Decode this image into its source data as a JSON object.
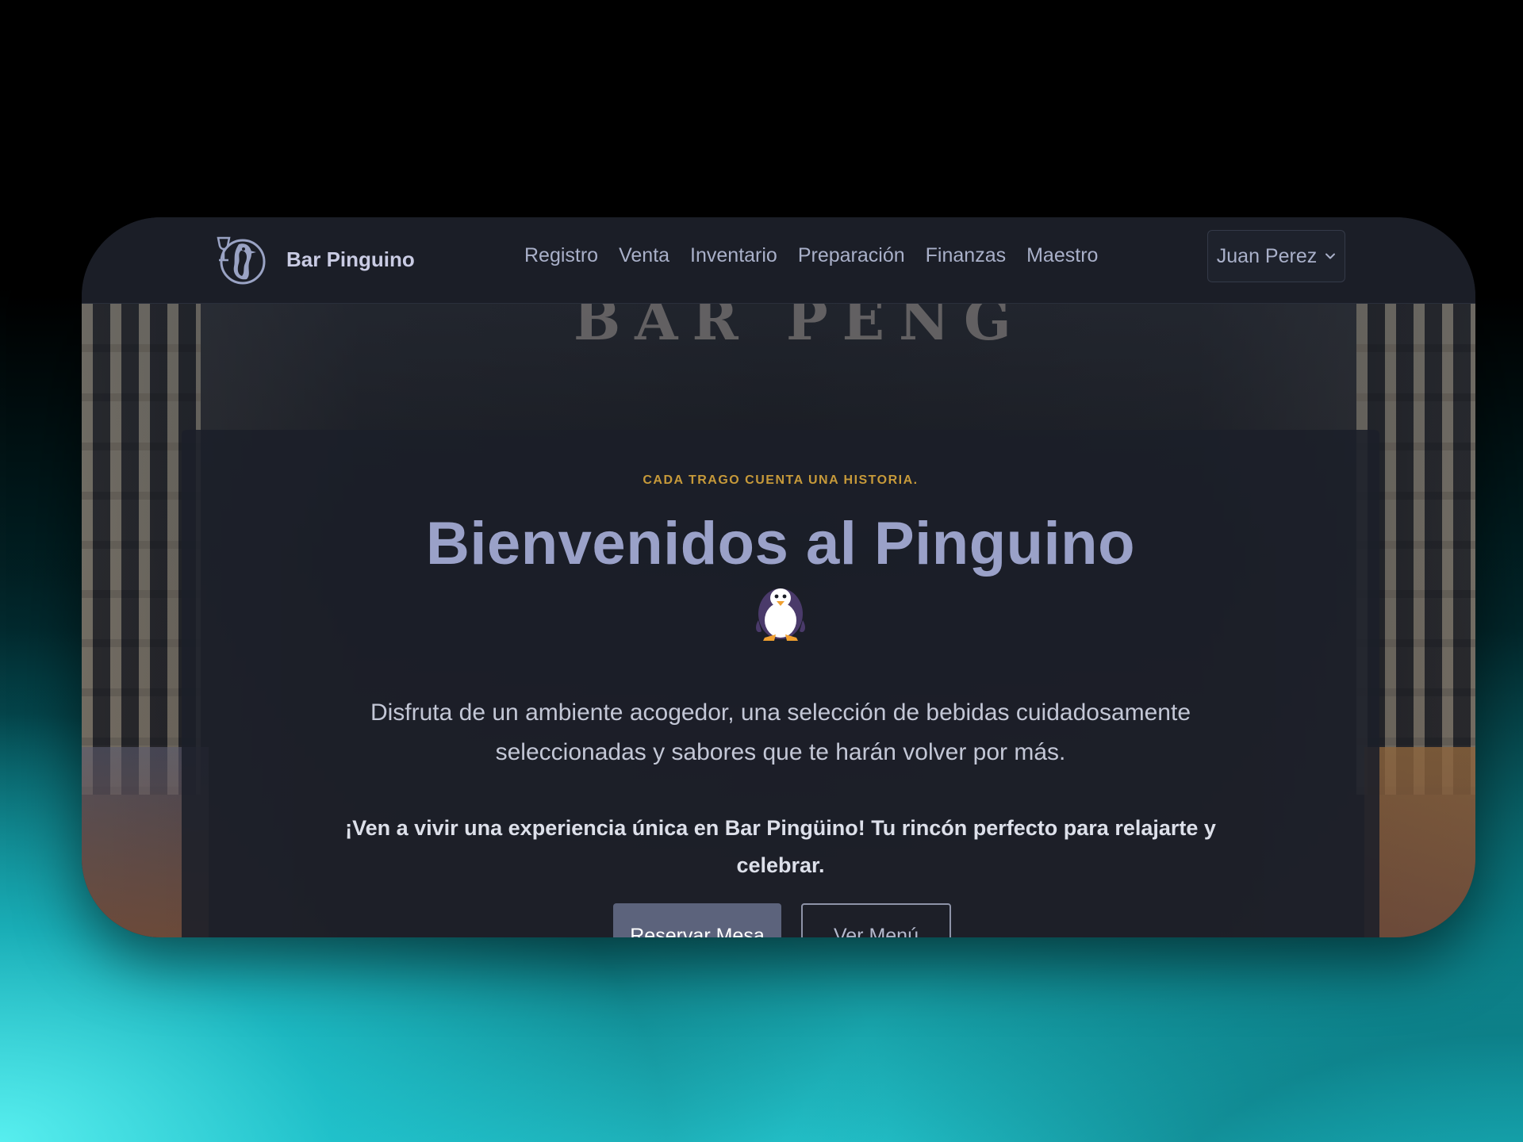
{
  "navbar": {
    "brand_name": "Bar Pinguino",
    "links": [
      "Registro",
      "Venta",
      "Inventario",
      "Preparación",
      "Finanzas",
      "Maestro"
    ],
    "user_name": "Juan Perez"
  },
  "hero": {
    "background_sign": "BAR PENG",
    "tagline": "Cada trago cuenta una historia.",
    "title": "Bienvenidos al Pinguino",
    "description": "Disfruta de un ambiente acogedor, una selección de bebidas cuidadosamente seleccionadas y sabores que te harán volver por más.",
    "cta_text": "¡Ven a vivir una experiencia única en Bar Pingüino! Tu rincón perfecto para relajarte y celebrar.",
    "buttons": {
      "reserve": "Reservar Mesa",
      "menu": "Ver Menú"
    }
  },
  "icons": {
    "logo": "penguin-wine-logo-icon",
    "mascot": "penguin-icon",
    "dropdown": "chevron-down-icon"
  },
  "colors": {
    "title": "#9aa1c8",
    "tagline": "#c79a3a",
    "primary_button": "#5c637c",
    "navbar_bg": "#1b1e27",
    "panel_bg": "#1b1f29"
  }
}
